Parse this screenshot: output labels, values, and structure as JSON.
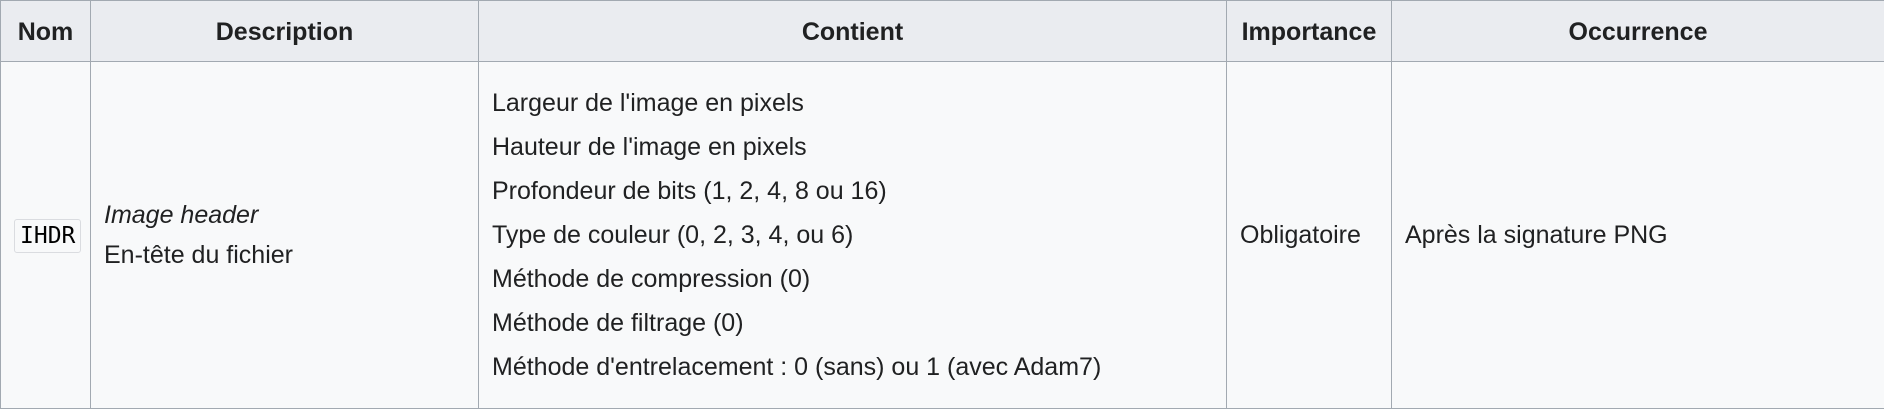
{
  "table": {
    "headers": [
      "Nom",
      "Description",
      "Contient",
      "Importance",
      "Occurrence"
    ],
    "rows": [
      {
        "nom": "IHDR",
        "description_italic": "Image header",
        "description": "En-tête du fichier",
        "contient": [
          "Largeur de l'image en pixels",
          "Hauteur de l'image en pixels",
          "Profondeur de bits (1, 2, 4, 8 ou 16)",
          "Type de couleur (0, 2, 3, 4, ou 6)",
          "Méthode de compression (0)",
          "Méthode de filtrage (0)",
          "Méthode d'entrelacement : 0 (sans) ou 1 (avec Adam7)"
        ],
        "importance": "Obligatoire",
        "occurrence": "Après la signature PNG"
      }
    ]
  }
}
